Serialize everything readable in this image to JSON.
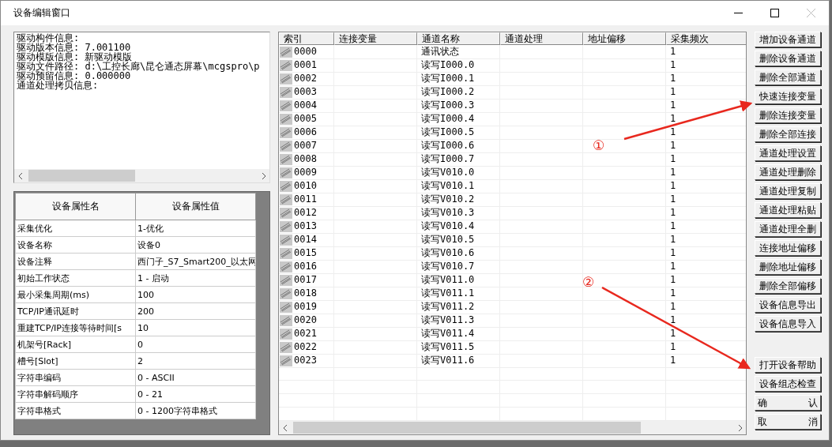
{
  "window": {
    "title": "设备编辑窗口"
  },
  "info_lines": [
    "驱动构件信息:",
    "驱动版本信息: 7.001100",
    "驱动模版信息: 新驱动模版",
    "驱动文件路径: d:\\工控长廊\\昆仑通态屏幕\\mcgspro\\p",
    "驱动预留信息: 0.000000",
    "通道处理拷贝信息:"
  ],
  "properties": {
    "columns": [
      "设备属性名",
      "设备属性值"
    ],
    "rows": [
      [
        "采集优化",
        "1-优化"
      ],
      [
        "设备名称",
        "设备0"
      ],
      [
        "设备注释",
        "西门子_S7_Smart200_以太网"
      ],
      [
        "初始工作状态",
        "1 - 启动"
      ],
      [
        "最小采集周期(ms)",
        "100"
      ],
      [
        "TCP/IP通讯延时",
        "200"
      ],
      [
        "重建TCP/IP连接等待时间[s",
        "10"
      ],
      [
        "机架号[Rack]",
        "0"
      ],
      [
        "槽号[Slot]",
        "2"
      ],
      [
        "字符串编码",
        "0 - ASCII"
      ],
      [
        "字符串解码顺序",
        "0 - 21"
      ],
      [
        "字符串格式",
        "0 - 1200字符串格式"
      ]
    ]
  },
  "channels": {
    "columns": [
      "索引",
      "连接变量",
      "通道名称",
      "通道处理",
      "地址偏移",
      "采集频次"
    ],
    "rows": [
      [
        "0000",
        "",
        "通讯状态",
        "",
        "",
        "1"
      ],
      [
        "0001",
        "",
        "读写I000.0",
        "",
        "",
        "1"
      ],
      [
        "0002",
        "",
        "读写I000.1",
        "",
        "",
        "1"
      ],
      [
        "0003",
        "",
        "读写I000.2",
        "",
        "",
        "1"
      ],
      [
        "0004",
        "",
        "读写I000.3",
        "",
        "",
        "1"
      ],
      [
        "0005",
        "",
        "读写I000.4",
        "",
        "",
        "1"
      ],
      [
        "0006",
        "",
        "读写I000.5",
        "",
        "",
        "1"
      ],
      [
        "0007",
        "",
        "读写I000.6",
        "",
        "",
        "1"
      ],
      [
        "0008",
        "",
        "读写I000.7",
        "",
        "",
        "1"
      ],
      [
        "0009",
        "",
        "读写V010.0",
        "",
        "",
        "1"
      ],
      [
        "0010",
        "",
        "读写V010.1",
        "",
        "",
        "1"
      ],
      [
        "0011",
        "",
        "读写V010.2",
        "",
        "",
        "1"
      ],
      [
        "0012",
        "",
        "读写V010.3",
        "",
        "",
        "1"
      ],
      [
        "0013",
        "",
        "读写V010.4",
        "",
        "",
        "1"
      ],
      [
        "0014",
        "",
        "读写V010.5",
        "",
        "",
        "1"
      ],
      [
        "0015",
        "",
        "读写V010.6",
        "",
        "",
        "1"
      ],
      [
        "0016",
        "",
        "读写V010.7",
        "",
        "",
        "1"
      ],
      [
        "0017",
        "",
        "读写V011.0",
        "",
        "",
        "1"
      ],
      [
        "0018",
        "",
        "读写V011.1",
        "",
        "",
        "1"
      ],
      [
        "0019",
        "",
        "读写V011.2",
        "",
        "",
        "1"
      ],
      [
        "0020",
        "",
        "读写V011.3",
        "",
        "",
        "1"
      ],
      [
        "0021",
        "",
        "读写V011.4",
        "",
        "",
        "1"
      ],
      [
        "0022",
        "",
        "读写V011.5",
        "",
        "",
        "1"
      ],
      [
        "0023",
        "",
        "读写V011.6",
        "",
        "",
        "1"
      ]
    ]
  },
  "buttons": [
    {
      "label": "增加设备通道",
      "kind": "normal"
    },
    {
      "label": "删除设备通道",
      "kind": "normal"
    },
    {
      "label": "删除全部通道",
      "kind": "normal"
    },
    {
      "label": "快速连接变量",
      "kind": "normal"
    },
    {
      "label": "删除连接变量",
      "kind": "normal"
    },
    {
      "label": "删除全部连接",
      "kind": "normal"
    },
    {
      "label": "通道处理设置",
      "kind": "normal"
    },
    {
      "label": "通道处理删除",
      "kind": "normal"
    },
    {
      "label": "通道处理复制",
      "kind": "normal"
    },
    {
      "label": "通道处理粘贴",
      "kind": "normal"
    },
    {
      "label": "通道处理全删",
      "kind": "normal"
    },
    {
      "label": "连接地址偏移",
      "kind": "normal"
    },
    {
      "label": "删除地址偏移",
      "kind": "normal"
    },
    {
      "label": "删除全部偏移",
      "kind": "normal"
    },
    {
      "label": "设备信息导出",
      "kind": "normal"
    },
    {
      "label": "设备信息导入",
      "kind": "normal"
    },
    {
      "label": "打开设备帮助",
      "kind": "separated"
    },
    {
      "label": "设备组态检查",
      "kind": "normal"
    },
    {
      "label": "确 认",
      "kind": "spread"
    },
    {
      "label": "取 消",
      "kind": "spread"
    }
  ],
  "annotations": [
    {
      "label": "①"
    },
    {
      "label": "②"
    }
  ]
}
